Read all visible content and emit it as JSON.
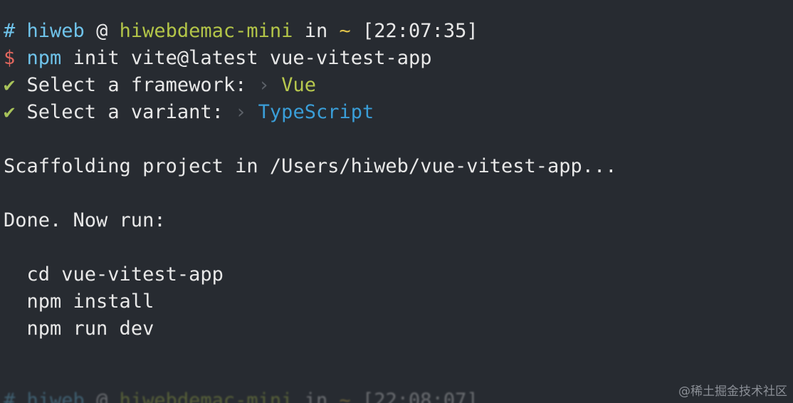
{
  "prompt": {
    "hash": "#",
    "user": "hiweb",
    "at": "@",
    "host": "hiwebdemac-mini",
    "in": "in",
    "dir": "~",
    "time": "[22:07:35]"
  },
  "command": {
    "dollar": "$",
    "program": "npm",
    "args": "init vite@latest vue-vitest-app"
  },
  "questions": [
    {
      "check": "✔",
      "label": "Select a framework:",
      "arrow": "›",
      "answer": "Vue"
    },
    {
      "check": "✔",
      "label": "Select a variant:",
      "arrow": "›",
      "answer": "TypeScript"
    }
  ],
  "scaffolding": "Scaffolding project in /Users/hiweb/vue-vitest-app...",
  "done": "Done. Now run:",
  "next_steps": [
    "cd vue-vitest-app",
    "npm install",
    "npm run dev"
  ],
  "prompt2": {
    "hash": "#",
    "user": "hiweb",
    "at": "@",
    "host": "hiwebdemac-mini",
    "in": "in",
    "dir": "~",
    "time": "[22:08:07]"
  },
  "watermark": "@稀土掘金技术社区"
}
